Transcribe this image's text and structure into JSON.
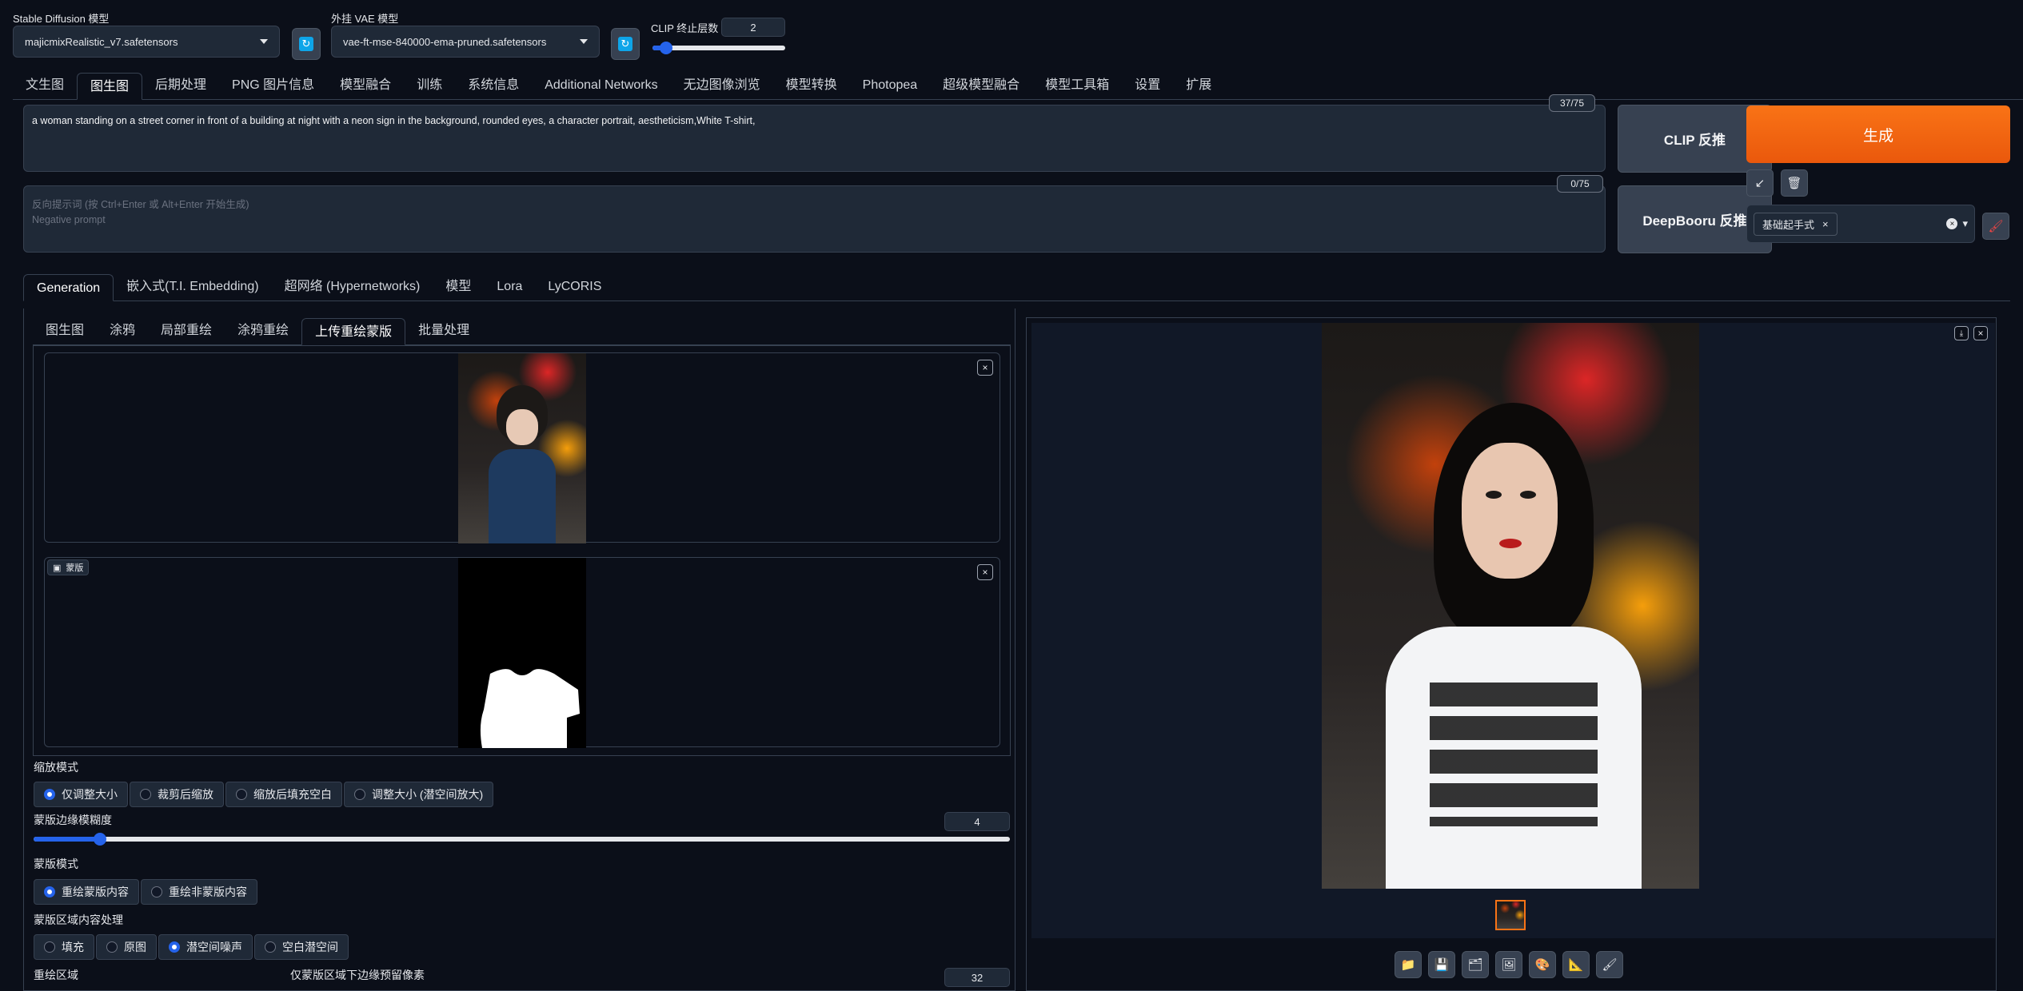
{
  "top": {
    "sd_model_label": "Stable Diffusion 模型",
    "sd_model_value": "majicmixRealistic_v7.safetensors",
    "vae_label": "外挂 VAE 模型",
    "vae_value": "vae-ft-mse-840000-ema-pruned.safetensors",
    "clip_label": "CLIP 终止层数",
    "clip_value": "2",
    "clip_level": 0.1
  },
  "main_tabs": [
    "文生图",
    "图生图",
    "后期处理",
    "PNG 图片信息",
    "模型融合",
    "训练",
    "系统信息",
    "Additional Networks",
    "无边图像浏览",
    "模型转换",
    "Photopea",
    "超级模型融合",
    "模型工具箱",
    "设置",
    "扩展"
  ],
  "prompt": {
    "text": "a woman standing on a street corner in front of a building at night with a neon sign in the background, rounded eyes, a character portrait, aestheticism,White T-shirt,",
    "counter": "37/75"
  },
  "negative": {
    "placeholder_line1": "反向提示词 (按 Ctrl+Enter 或 Alt+Enter 开始生成)",
    "placeholder_line2": "Negative prompt",
    "counter": "0/75"
  },
  "buttons": {
    "clip": "CLIP 反推",
    "deepbooru": "DeepBooru 反推",
    "generate": "生成",
    "style_tag": "基础起手式"
  },
  "sub_tabs": [
    "Generation",
    "嵌入式(T.I. Embedding)",
    "超网络 (Hypernetworks)",
    "模型",
    "Lora",
    "LyCORIS"
  ],
  "img_tabs": [
    "图生图",
    "涂鸦",
    "局部重绘",
    "涂鸦重绘",
    "上传重绘蒙版",
    "批量处理"
  ],
  "mask_label": "蒙版",
  "resize_mode": {
    "label": "缩放模式",
    "options": [
      "仅调整大小",
      "裁剪后缩放",
      "缩放后填充空白",
      "调整大小 (潜空间放大)"
    ],
    "selected": 0
  },
  "mask_blur": {
    "label": "蒙版边缘模糊度",
    "value": "4",
    "level": 0.068
  },
  "mask_mode": {
    "label": "蒙版模式",
    "options": [
      "重绘蒙版内容",
      "重绘非蒙版内容"
    ],
    "selected": 0
  },
  "masked_content": {
    "label": "蒙版区域内容处理",
    "options": [
      "填充",
      "原图",
      "潜空间噪声",
      "空白潜空间"
    ],
    "selected": 2
  },
  "inpaint_area": {
    "label": "重绘区域",
    "padding_label": "仅蒙版区域下边缘预留像素",
    "padding_value": "32"
  },
  "output_tools": [
    "folder-icon",
    "save-icon",
    "zip-icon",
    "image-icon",
    "palette-icon",
    "ruler-icon",
    "brush-icon"
  ],
  "colors": {
    "accent": "#2563eb",
    "generate": "#f97316",
    "bg": "#0b0f19",
    "panel": "#1f2937"
  }
}
